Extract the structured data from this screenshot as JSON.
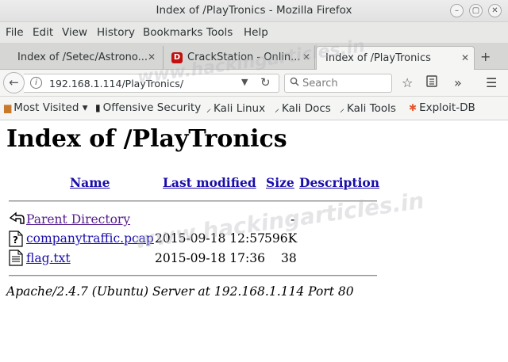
{
  "window": {
    "title": "Index of /PlayTronics - Mozilla Firefox"
  },
  "menu": [
    "File",
    "Edit",
    "View",
    "History",
    "Bookmarks",
    "Tools",
    "Help"
  ],
  "tabs": [
    {
      "label": "Index of /Setec/Astrono...",
      "active": false
    },
    {
      "label": "CrackStation - Onlin...",
      "active": false,
      "favicon": "D"
    },
    {
      "label": "Index of /PlayTronics",
      "active": true
    }
  ],
  "navbar": {
    "url": "192.168.1.114/PlayTronics/",
    "search_placeholder": "Search"
  },
  "bookmarks": [
    {
      "label": "Most Visited ▾",
      "icon": "folder-icon"
    },
    {
      "label": "Offensive Security",
      "icon": "offsec-icon"
    },
    {
      "label": "Kali Linux",
      "icon": "kali-dragon-icon"
    },
    {
      "label": "Kali Docs",
      "icon": "kali-dragon-icon"
    },
    {
      "label": "Kali Tools",
      "icon": "kali-dragon-icon"
    },
    {
      "label": "Exploit-DB",
      "icon": "exploitdb-icon"
    }
  ],
  "page": {
    "heading": "Index of /PlayTronics",
    "columns": {
      "name": "Name",
      "last_modified": "Last modified",
      "size": "Size",
      "description": "Description"
    },
    "rows": [
      {
        "name": "Parent Directory",
        "modified": "",
        "size": "-",
        "icon": "back-arrow-icon",
        "visited": true
      },
      {
        "name": "companytraffic.pcap",
        "modified": "2015-09-18 12:57",
        "size": "596K",
        "icon": "unknown-file-icon",
        "visited": false
      },
      {
        "name": "flag.txt",
        "modified": "2015-09-18 17:36",
        "size": "38",
        "icon": "text-file-icon",
        "visited": false
      }
    ],
    "footer": "Apache/2.4.7 (Ubuntu) Server at 192.168.1.114 Port 80"
  },
  "watermark": "www.hackingarticles.in",
  "colors": {
    "link": "#1a0dab",
    "visited_link": "#551a8b",
    "kali_icon": "#1f1f1f",
    "exploitdb_icon": "#e4572e"
  }
}
